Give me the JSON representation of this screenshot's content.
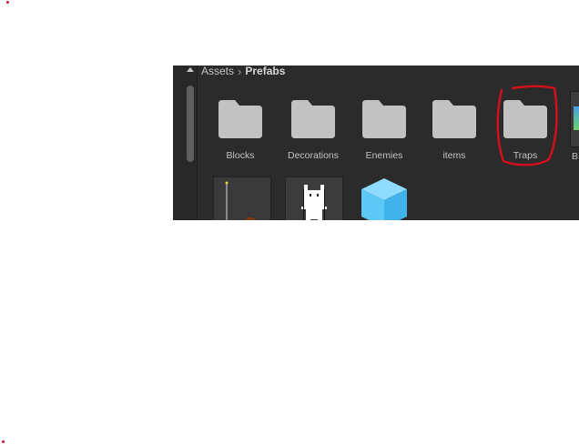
{
  "breadcrumb": {
    "root": "Assets",
    "current": "Prefabs"
  },
  "folders": [
    {
      "label": "Blocks"
    },
    {
      "label": "Decorations"
    },
    {
      "label": "Enemies"
    },
    {
      "label": "items"
    },
    {
      "label": "Traps"
    },
    {
      "label": "B"
    }
  ],
  "colors": {
    "panel_bg": "#2b2b2b",
    "folder_icon": "#c2c2c2",
    "annotation_red": "#d0101a",
    "cube": "#5cc8f5"
  },
  "icons": [
    "folder-icon",
    "cat-sprite",
    "cube-icon",
    "pole-sprite"
  ]
}
